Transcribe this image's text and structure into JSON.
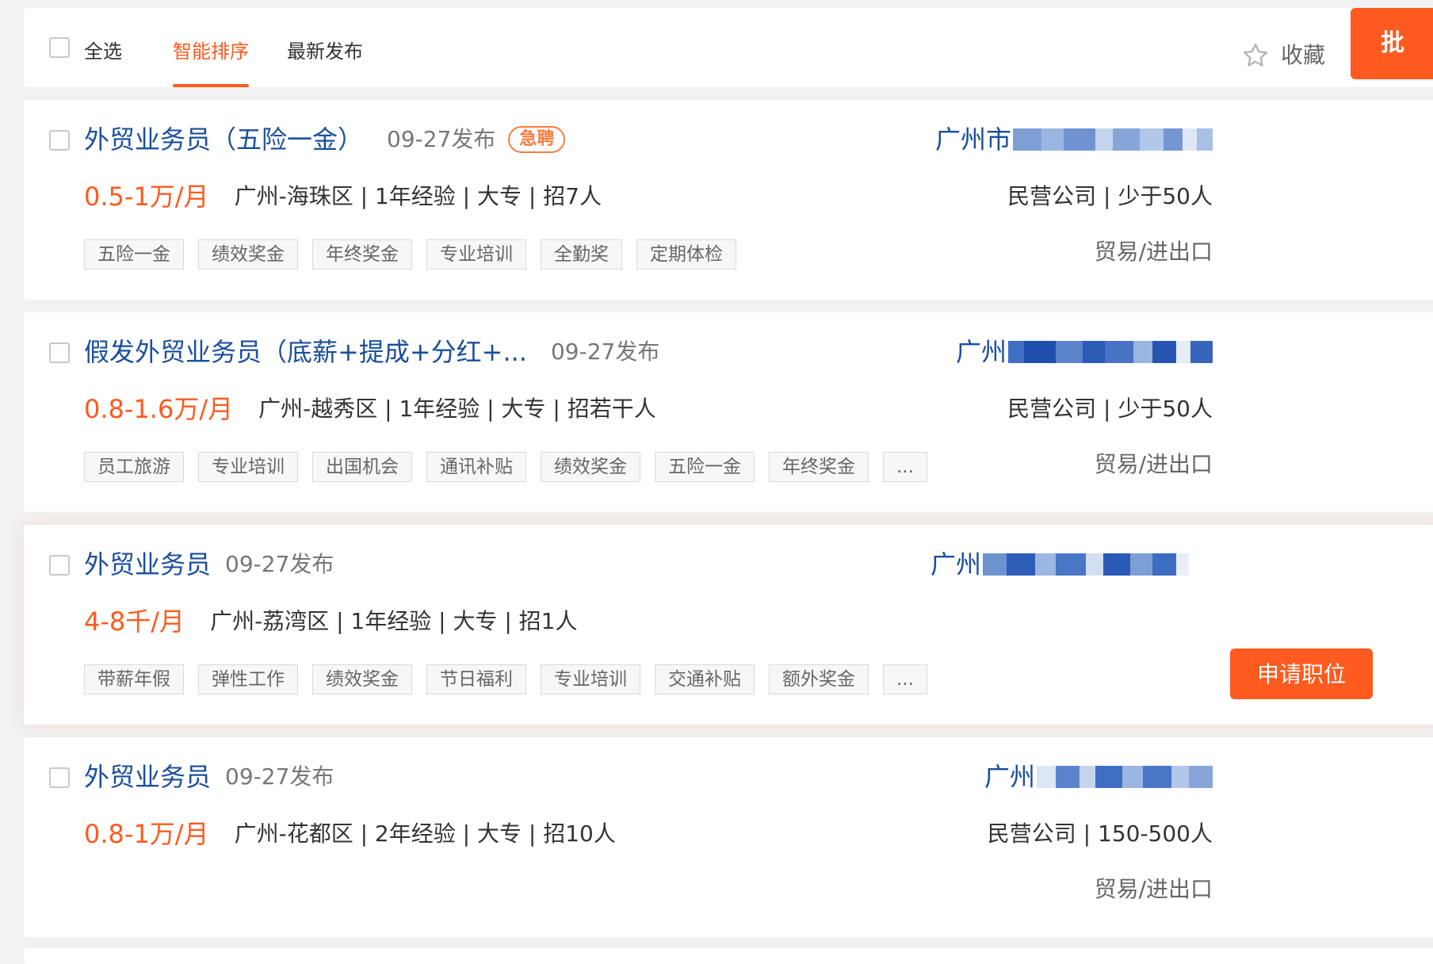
{
  "toolbar": {
    "select_all": "全选",
    "sort_smart": "智能排序",
    "sort_latest": "最新发布",
    "favorite": "收藏",
    "bulk_label": "批"
  },
  "colors": {
    "accent": "#ff5a1f",
    "title_blue": "#1a4f9c",
    "urgent": "#ff7a3d"
  },
  "jobs": [
    {
      "title": "外贸业务员（五险一金）",
      "date": "09-27发布",
      "urgent_badge": "急聘",
      "salary": "0.5-1万/月",
      "requirements": "广州-海珠区 | 1年经验 | 大专 | 招7人",
      "company_visible": "广州市",
      "company_info": "民营公司 | 少于50人",
      "industry": "贸易/进出口",
      "tags": [
        "五险一金",
        "绩效奖金",
        "年终奖金",
        "专业培训",
        "全勤奖",
        "定期体检"
      ]
    },
    {
      "title": "假发外贸业务员（底薪+提成+分红+...",
      "date": "09-27发布",
      "salary": "0.8-1.6万/月",
      "requirements": "广州-越秀区 | 1年经验 | 大专 | 招若干人",
      "company_visible": "广州",
      "company_info": "民营公司 | 少于50人",
      "industry": "贸易/进出口",
      "tags": [
        "员工旅游",
        "专业培训",
        "出国机会",
        "通讯补贴",
        "绩效奖金",
        "五险一金",
        "年终奖金",
        "..."
      ]
    },
    {
      "title": "外贸业务员",
      "date": "09-27发布",
      "salary": "4-8千/月",
      "requirements": "广州-荔湾区 | 1年经验 | 大专 | 招1人",
      "company_visible": "广州",
      "apply_label": "申请职位",
      "tags": [
        "带薪年假",
        "弹性工作",
        "绩效奖金",
        "节日福利",
        "专业培训",
        "交通补贴",
        "额外奖金",
        "..."
      ]
    },
    {
      "title": "外贸业务员",
      "date": "09-27发布",
      "salary": "0.8-1万/月",
      "requirements": "广州-花都区 | 2年经验 | 大专 | 招10人",
      "company_visible": "广州",
      "company_info": "民营公司 | 150-500人",
      "industry": "贸易/进出口",
      "tags": []
    }
  ]
}
